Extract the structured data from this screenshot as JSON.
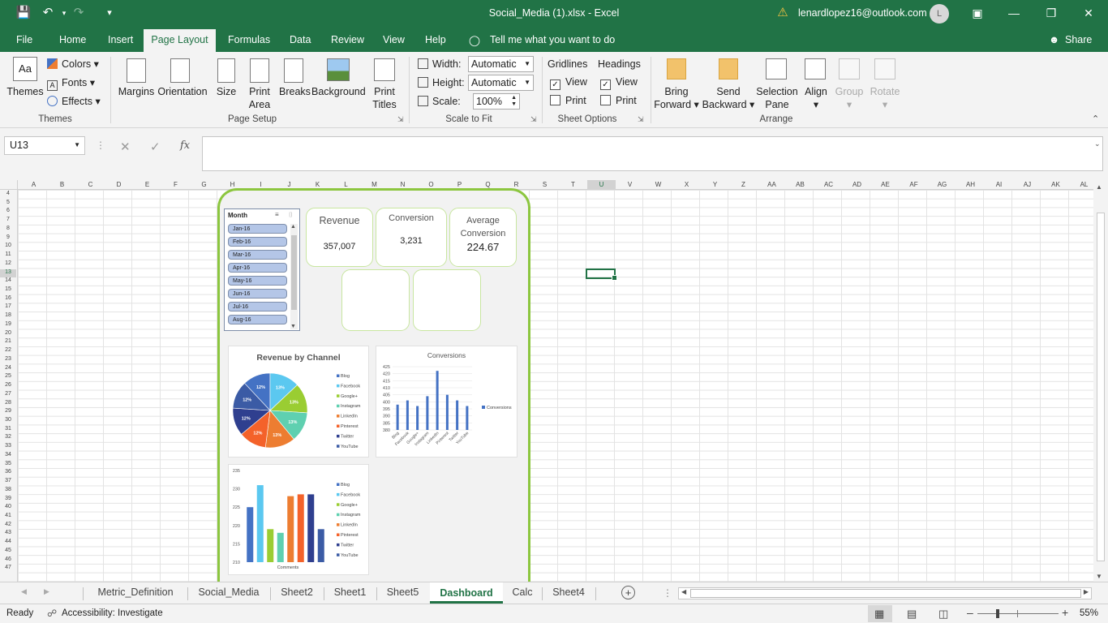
{
  "titlebar": {
    "doc_title": "Social_Media (1).xlsx  -  Excel",
    "account": "lenardlopez16@outlook.com",
    "avatar_initial": "L"
  },
  "menu": {
    "file": "File",
    "home": "Home",
    "insert": "Insert",
    "page_layout": "Page Layout",
    "formulas": "Formulas",
    "data": "Data",
    "review": "Review",
    "view": "View",
    "help": "Help",
    "tell_me": "Tell me what you want to do",
    "share": "Share"
  },
  "ribbon": {
    "themes": {
      "label": "Themes",
      "colors": "Colors",
      "fonts": "Fonts",
      "effects": "Effects",
      "group": "Themes"
    },
    "page_setup": {
      "margins": "Margins",
      "orientation": "Orientation",
      "size": "Size",
      "print_area_1": "Print",
      "print_area_2": "Area",
      "breaks": "Breaks",
      "background": "Background",
      "print_titles_1": "Print",
      "print_titles_2": "Titles",
      "group": "Page Setup"
    },
    "scale_to_fit": {
      "width_label": "Width:",
      "width_value": "Automatic",
      "height_label": "Height:",
      "height_value": "Automatic",
      "scale_label": "Scale:",
      "scale_value": "100%",
      "group": "Scale to Fit"
    },
    "sheet_options": {
      "gridlines": "Gridlines",
      "headings": "Headings",
      "view": "View",
      "print": "Print",
      "group": "Sheet Options"
    },
    "arrange": {
      "bring_forward_1": "Bring",
      "bring_forward_2": "Forward",
      "send_backward_1": "Send",
      "send_backward_2": "Backward",
      "selection_pane_1": "Selection",
      "selection_pane_2": "Pane",
      "align": "Align",
      "group_btn": "Group",
      "rotate": "Rotate",
      "group": "Arrange"
    }
  },
  "formula_bar": {
    "name_box": "U13",
    "fx": "fx",
    "formula": ""
  },
  "columns": [
    "A",
    "B",
    "C",
    "D",
    "E",
    "F",
    "G",
    "H",
    "I",
    "J",
    "K",
    "L",
    "M",
    "N",
    "O",
    "P",
    "Q",
    "R",
    "S",
    "T",
    "U",
    "V",
    "W",
    "X",
    "Y",
    "Z",
    "AA",
    "AB",
    "AC",
    "AD",
    "AE",
    "AF",
    "AG",
    "AH",
    "AI",
    "AJ",
    "AK",
    "AL"
  ],
  "rows": [
    "4",
    "5",
    "6",
    "7",
    "8",
    "9",
    "10",
    "11",
    "12",
    "13",
    "14",
    "15",
    "16",
    "17",
    "18",
    "19",
    "20",
    "21",
    "22",
    "23",
    "24",
    "25",
    "26",
    "27",
    "28",
    "29",
    "30",
    "31",
    "32",
    "33",
    "34",
    "35",
    "36",
    "37",
    "38",
    "39",
    "40",
    "41",
    "42",
    "43",
    "44",
    "45",
    "46",
    "47"
  ],
  "dashboard": {
    "slicer": {
      "title": "Month",
      "items": [
        "Jan-16",
        "Feb-16",
        "Mar-16",
        "Apr-16",
        "May-16",
        "Jun-16",
        "Jul-16",
        "Aug-16"
      ]
    },
    "kpis": {
      "revenue": {
        "title": "Revenue",
        "value": "357,007"
      },
      "conversion": {
        "title": "Conversion",
        "value": "3,231"
      },
      "avg_conversion": {
        "title_1": "Average",
        "title_2": "Conversion",
        "value": "224.67"
      }
    },
    "legend": [
      "Blog",
      "Facebook",
      "Google+",
      "Instagram",
      "LinkedIn",
      "Pinterest",
      "Twitter",
      "YouTube"
    ],
    "colors": {
      "Blog": "#4472c4",
      "Facebook": "#5bc8f0",
      "Google+": "#9acd32",
      "Instagram": "#5fd0b0",
      "LinkedIn": "#ed7d31",
      "Pinterest": "#f4622a",
      "Twitter": "#2f3f8f",
      "YouTube": "#3b5ba5"
    }
  },
  "chart_data": [
    {
      "type": "pie",
      "title": "Revenue by Channel",
      "categories": [
        "Blog",
        "Facebook",
        "Google+",
        "Instagram",
        "LinkedIn",
        "Pinterest",
        "Twitter",
        "YouTube"
      ],
      "values": [
        12,
        13,
        13,
        13,
        13,
        12,
        12,
        12
      ],
      "data_labels": [
        "12%",
        "13%",
        "13%",
        "13%",
        "13%",
        "12%",
        "12%",
        "12%"
      ]
    },
    {
      "type": "bar",
      "title": "Conversions",
      "categories": [
        "Blog",
        "Facebook",
        "Google+",
        "Instagram",
        "LinkedIn",
        "Pinterest",
        "Twitter",
        "YouTube"
      ],
      "series": [
        {
          "name": "Conversions",
          "values": [
            398,
            401,
            397,
            404,
            422,
            405,
            401,
            397
          ]
        }
      ],
      "ylim": [
        380,
        425
      ],
      "yticks": [
        "425",
        "420",
        "415",
        "410",
        "405",
        "400",
        "395",
        "390",
        "385",
        "380"
      ]
    },
    {
      "type": "bar",
      "title": "",
      "xlabel": "Comments",
      "categories": [
        "Blog",
        "Facebook",
        "Google+",
        "Instagram",
        "LinkedIn",
        "Pinterest",
        "Twitter",
        "YouTube"
      ],
      "values": [
        225,
        231,
        219,
        218,
        228,
        228.5,
        228.5,
        219
      ],
      "ylim": [
        210,
        235
      ],
      "yticks": [
        "235",
        "230",
        "225",
        "220",
        "215",
        "210"
      ]
    }
  ],
  "sheet_tabs": [
    "Metric_Definition",
    "Social_Media",
    "Sheet2",
    "Sheet1",
    "Sheet5",
    "Dashboard",
    "Calc",
    "Sheet4"
  ],
  "status": {
    "ready": "Ready",
    "accessibility": "Accessibility: Investigate",
    "zoom": "55%"
  }
}
